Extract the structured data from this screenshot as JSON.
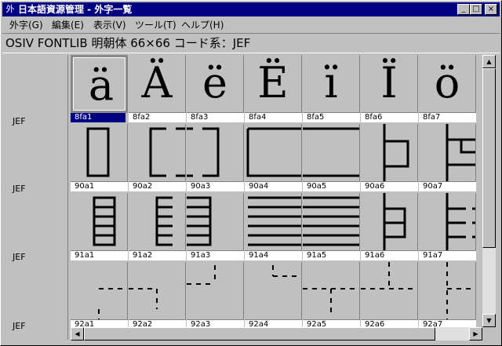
{
  "window": {
    "title": "日本語資源管理 - 外字一覧",
    "app_icon": "外",
    "controls": {
      "minimize": "_",
      "maximize": "□",
      "close": "×"
    }
  },
  "menu": [
    {
      "label": "外字(G)"
    },
    {
      "label": "編集(E)"
    },
    {
      "label": "表示(V)"
    },
    {
      "label": "ツール(T)"
    },
    {
      "label": "ヘルプ(H)"
    }
  ],
  "info": {
    "text": "OSIV FONTLIB 明朝体 66×66 コード系：JEF"
  },
  "rows": [
    {
      "label": "JEF"
    },
    {
      "label": "JEF"
    },
    {
      "label": "JEF"
    },
    {
      "label": "JEF"
    }
  ],
  "cells": [
    {
      "code": "8fa1",
      "glyph": "ä",
      "selected": true
    },
    {
      "code": "8fa2",
      "glyph": "Ä"
    },
    {
      "code": "8fa3",
      "glyph": "ë"
    },
    {
      "code": "8fa4",
      "glyph": "Ë"
    },
    {
      "code": "8fa5",
      "glyph": "ï"
    },
    {
      "code": "8fa6",
      "glyph": "Ï"
    },
    {
      "code": "8fa7",
      "glyph": "ö"
    },
    {
      "code": "90a1"
    },
    {
      "code": "90a2"
    },
    {
      "code": "90a3"
    },
    {
      "code": "90a4"
    },
    {
      "code": "90a5"
    },
    {
      "code": "90a6"
    },
    {
      "code": "90a7"
    },
    {
      "code": "91a1"
    },
    {
      "code": "91a2"
    },
    {
      "code": "91a3"
    },
    {
      "code": "91a4"
    },
    {
      "code": "91a5"
    },
    {
      "code": "91a6"
    },
    {
      "code": "91a7"
    },
    {
      "code": "92a1"
    },
    {
      "code": "92a2"
    },
    {
      "code": "92a3"
    },
    {
      "code": "92a4"
    },
    {
      "code": "92a5"
    },
    {
      "code": "92a6"
    },
    {
      "code": "92a7"
    }
  ],
  "scrollbars": {
    "up": "▲",
    "down": "▼",
    "left": "◀",
    "right": "▶"
  },
  "colors": {
    "titlebar": "#000080",
    "selection": "#000080",
    "face": "#c0c0c0"
  }
}
